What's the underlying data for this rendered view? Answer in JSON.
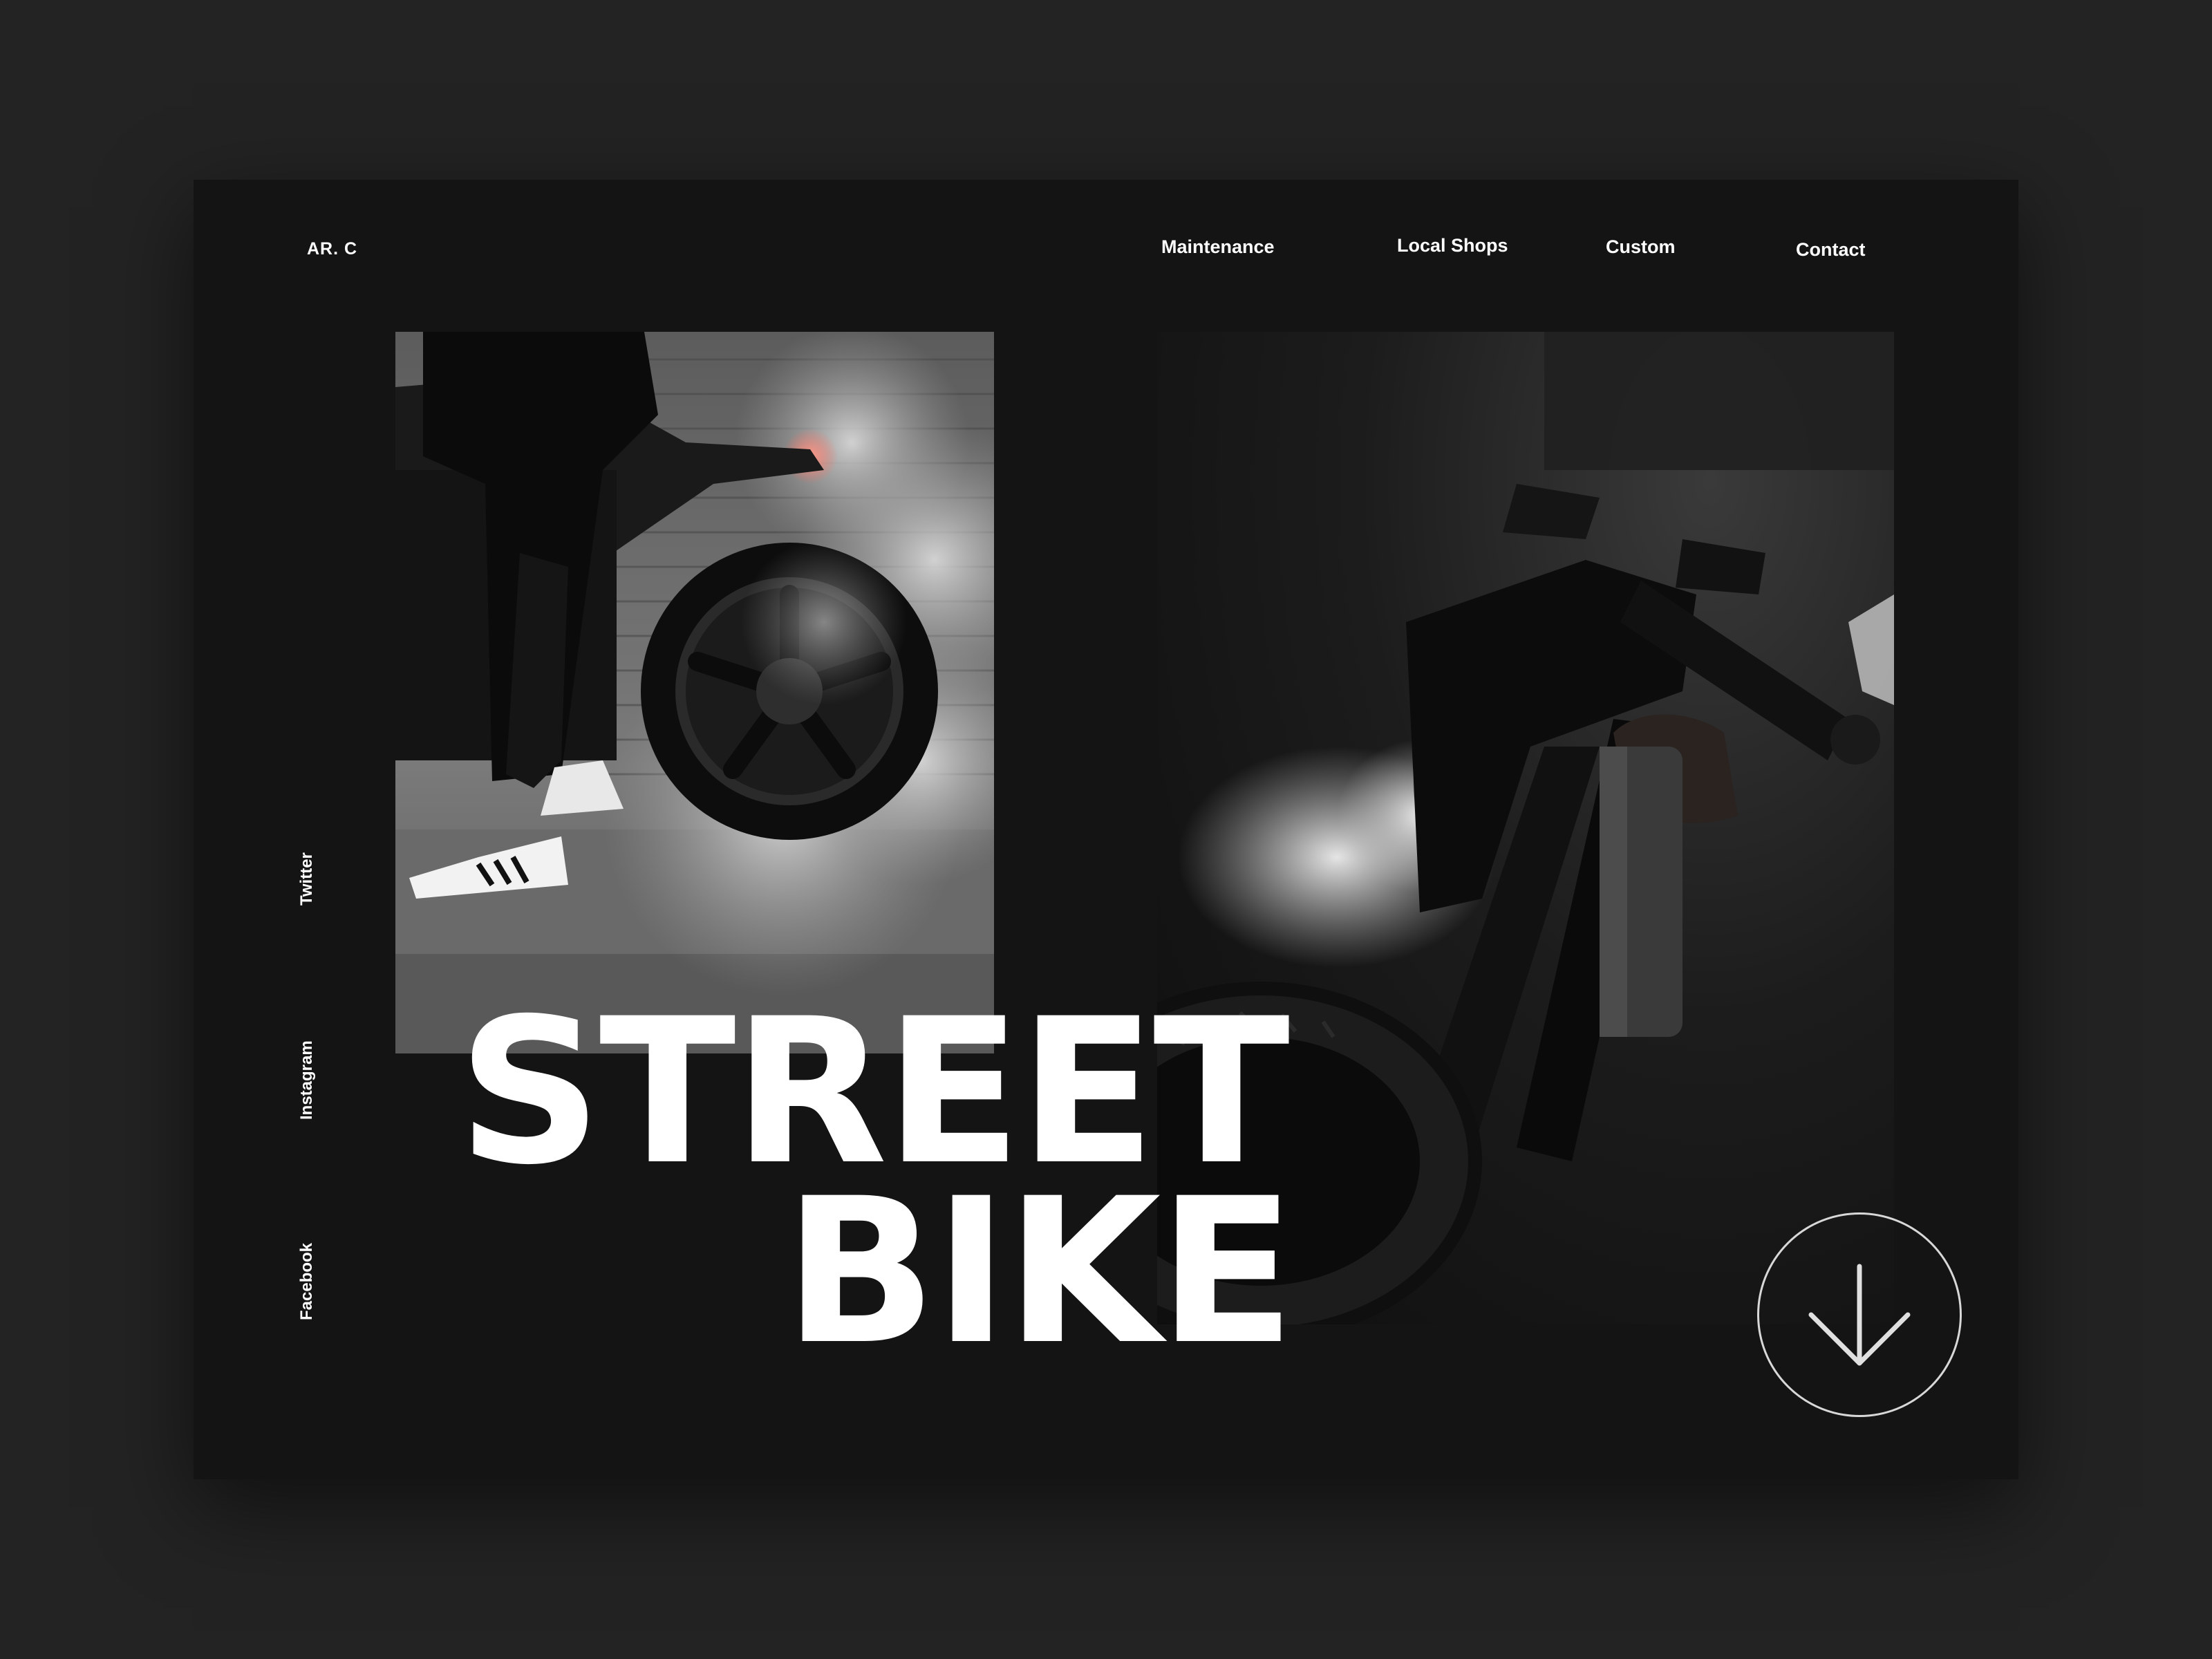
{
  "brand": {
    "logo": "AR. C"
  },
  "nav": {
    "items": [
      {
        "label": "Maintenance"
      },
      {
        "label": "Local Shops"
      },
      {
        "label": "Custom"
      },
      {
        "label": "Contact"
      }
    ]
  },
  "social": {
    "items": [
      {
        "label": "Twitter"
      },
      {
        "label": "Instagram"
      },
      {
        "label": "Facebook"
      }
    ]
  },
  "hero": {
    "line1": "STREET",
    "line2": "BIKE"
  },
  "scroll": {
    "icon": "arrow-down-icon"
  }
}
